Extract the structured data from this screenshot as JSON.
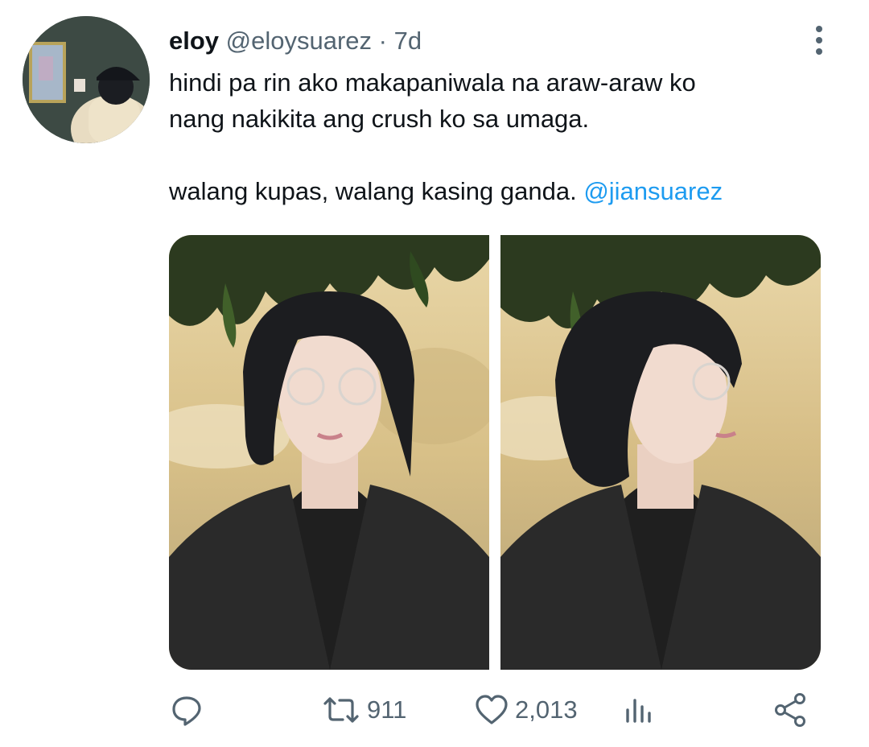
{
  "tweet": {
    "display_name": "eloy",
    "handle": "@eloysuarez",
    "separator": "·",
    "time": "7d",
    "text_line1": "hindi pa rin ako makapaniwala na araw-araw ko",
    "text_line2": "nang nakikita ang crush ko sa umaga.",
    "text_line3": "walang kupas, walang kasing ganda.",
    "mention": "@jiansuarez"
  },
  "actions": {
    "reply_icon": "reply-icon",
    "retweet_icon": "retweet-icon",
    "retweet_count": "911",
    "like_icon": "heart-icon",
    "like_count": "2,013",
    "analytics_icon": "analytics-icon",
    "share_icon": "share-icon"
  },
  "colors": {
    "accent": "#1d9bf0",
    "secondary_text": "#536471",
    "primary_text": "#0f1419"
  }
}
